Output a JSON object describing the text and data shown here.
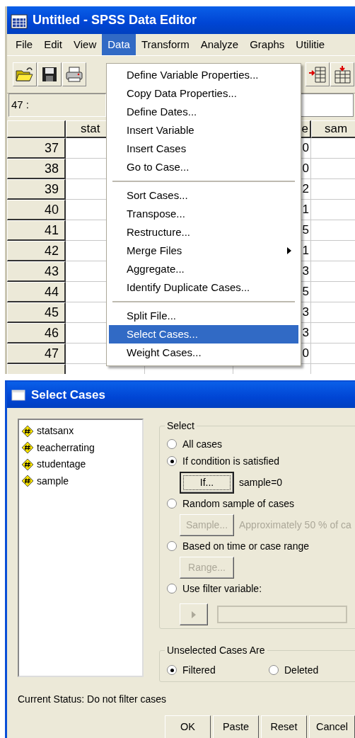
{
  "editor": {
    "title": "Untitled - SPSS Data Editor",
    "menu": [
      {
        "label": "File",
        "selected": false
      },
      {
        "label": "Edit",
        "selected": false
      },
      {
        "label": "View",
        "selected": false
      },
      {
        "label": "Data",
        "selected": true
      },
      {
        "label": "Transform",
        "selected": false
      },
      {
        "label": "Analyze",
        "selected": false
      },
      {
        "label": "Graphs",
        "selected": false
      },
      {
        "label": "Utilitie",
        "selected": false
      }
    ],
    "cell_ref": "47 :",
    "columns": [
      {
        "label": "stat"
      },
      {
        "label": "e"
      },
      {
        "label": "sam"
      }
    ],
    "rows": [
      {
        "number": "37",
        "value": "0"
      },
      {
        "number": "38",
        "value": "0"
      },
      {
        "number": "39",
        "value": "2"
      },
      {
        "number": "40",
        "value": "1"
      },
      {
        "number": "41",
        "value": "5"
      },
      {
        "number": "42",
        "value": "1"
      },
      {
        "number": "43",
        "value": "3"
      },
      {
        "number": "44",
        "value": "5"
      },
      {
        "number": "45",
        "value": "3"
      },
      {
        "number": "46",
        "value": "3"
      },
      {
        "number": "47",
        "value": "0"
      }
    ]
  },
  "data_menu": [
    {
      "kind": "item",
      "label": "Define Variable Properties...",
      "selected": false,
      "submenu": false
    },
    {
      "kind": "item",
      "label": "Copy Data Properties...",
      "selected": false,
      "submenu": false
    },
    {
      "kind": "item",
      "label": "Define Dates...",
      "selected": false,
      "submenu": false
    },
    {
      "kind": "item",
      "label": "Insert Variable",
      "selected": false,
      "submenu": false
    },
    {
      "kind": "item",
      "label": "Insert Cases",
      "selected": false,
      "submenu": false
    },
    {
      "kind": "item",
      "label": "Go to Case...",
      "selected": false,
      "submenu": false
    },
    {
      "kind": "separator"
    },
    {
      "kind": "item",
      "label": "Sort Cases...",
      "selected": false,
      "submenu": false
    },
    {
      "kind": "item",
      "label": "Transpose...",
      "selected": false,
      "submenu": false
    },
    {
      "kind": "item",
      "label": "Restructure...",
      "selected": false,
      "submenu": false
    },
    {
      "kind": "item",
      "label": "Merge Files",
      "selected": false,
      "submenu": true
    },
    {
      "kind": "item",
      "label": "Aggregate...",
      "selected": false,
      "submenu": false
    },
    {
      "kind": "item",
      "label": "Identify Duplicate Cases...",
      "selected": false,
      "submenu": false
    },
    {
      "kind": "separator"
    },
    {
      "kind": "item",
      "label": "Split File...",
      "selected": false,
      "submenu": false
    },
    {
      "kind": "item",
      "label": "Select Cases...",
      "selected": true,
      "submenu": false
    },
    {
      "kind": "item",
      "label": "Weight Cases...",
      "selected": false,
      "submenu": false
    }
  ],
  "dialog": {
    "title": "Select Cases",
    "variables": [
      "statsanx",
      "teacherrating",
      "studentage",
      "sample"
    ],
    "select": {
      "legend": "Select",
      "options": [
        {
          "label": "All cases",
          "selected": false
        },
        {
          "label": "If condition is satisfied",
          "selected": true,
          "button": {
            "label": "If...",
            "disabled": false,
            "focused": true
          },
          "note": "sample=0"
        },
        {
          "label": "Random sample of cases",
          "selected": false,
          "button": {
            "label": "Sample...",
            "disabled": true,
            "focused": false
          },
          "note": "Approximately 50 % of ca"
        },
        {
          "label": "Based on time or case range",
          "selected": false,
          "button": {
            "label": "Range...",
            "disabled": true,
            "focused": false
          }
        },
        {
          "label": "Use filter variable:",
          "selected": false,
          "filter": {
            "disabled": true
          }
        }
      ]
    },
    "unselected": {
      "legend": "Unselected Cases Are",
      "options": [
        {
          "label": "Filtered",
          "selected": true
        },
        {
          "label": "Deleted",
          "selected": false
        }
      ]
    },
    "status": "Current Status: Do not filter cases",
    "buttons": [
      "OK",
      "Paste",
      "Reset",
      "Cancel"
    ]
  }
}
